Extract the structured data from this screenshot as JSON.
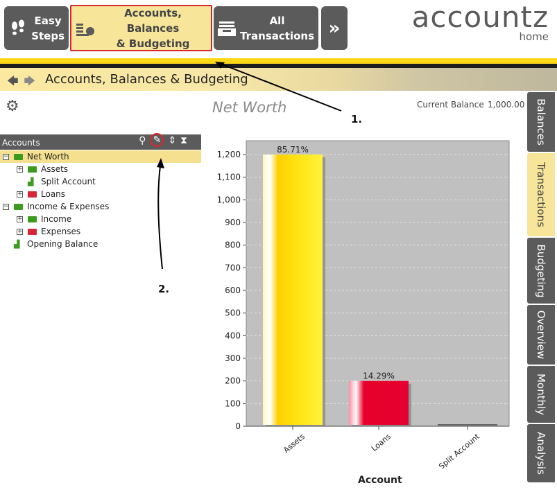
{
  "toolbar": {
    "easy_steps": "Easy Steps",
    "easy_steps_line1": "Easy",
    "easy_steps_line2": "Steps",
    "accounts_line1": "Accounts, Balances",
    "accounts_line2": "& Budgeting",
    "all_line1": "All",
    "all_line2": "Transactions"
  },
  "logo": {
    "name": "accountz",
    "edition": "home"
  },
  "breadcrumb": {
    "title": "Accounts, Balances & Budgeting"
  },
  "header": {
    "view_title": "Net Worth",
    "current_balance_label": "Current Balance",
    "current_balance_value": "1,000.00"
  },
  "accounts": {
    "title": "Accounts",
    "items": [
      {
        "label": "Net Worth",
        "level": 0,
        "expand": "−",
        "kind": "folder-green",
        "selected": true
      },
      {
        "label": "Assets",
        "level": 1,
        "expand": "+",
        "kind": "folder-green"
      },
      {
        "label": "Split Account",
        "level": 1,
        "expand": "",
        "kind": "blocks"
      },
      {
        "label": "Loans",
        "level": 1,
        "expand": "+",
        "kind": "folder-red"
      },
      {
        "label": "Income & Expenses",
        "level": 0,
        "expand": "−",
        "kind": "folder-green"
      },
      {
        "label": "Income",
        "level": 1,
        "expand": "+",
        "kind": "folder-green"
      },
      {
        "label": "Expenses",
        "level": 1,
        "expand": "+",
        "kind": "folder-red"
      },
      {
        "label": "Opening Balance",
        "level": 0,
        "expand": "",
        "kind": "blocks"
      }
    ]
  },
  "chart_data": {
    "type": "bar",
    "categories": [
      "Assets",
      "Loans",
      "Split Account"
    ],
    "values": [
      1200,
      200,
      0
    ],
    "data_labels": [
      "85.71%",
      "14.29%",
      ""
    ],
    "colors": [
      "#ffd21a",
      "#e0002a",
      "#888888"
    ],
    "xlabel": "Account",
    "ylabel": "",
    "ylim": [
      0,
      1200
    ],
    "yticks": [
      0,
      100,
      200,
      300,
      400,
      500,
      600,
      700,
      800,
      900,
      "1,000",
      "1,100",
      "1,200"
    ],
    "grid": true
  },
  "side_tabs": [
    "Balances",
    "Transactions",
    "Budgeting",
    "Overview",
    "Monthly",
    "Analysis"
  ],
  "annotations": {
    "first": "1.",
    "second": "2."
  }
}
